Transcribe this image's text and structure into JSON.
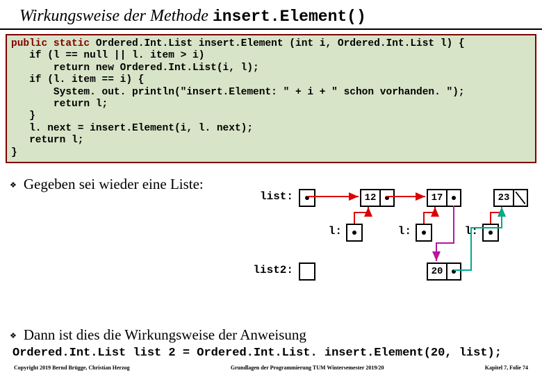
{
  "title": {
    "prefix": "Wirkungsweise der Methode ",
    "method": "insert.Element()"
  },
  "code": {
    "l1a": "public static ",
    "l1b": "Ordered.Int.List",
    "l1c": " insert.Element (int i, ",
    "l1d": "Ordered.Int.List",
    "l1e": " l) {",
    "l2": "   if (l == null || l. item > i)",
    "l3": "       return new Ordered.Int.List(i, l);",
    "l4": "   if (l. item == i) {",
    "l5": "       System. out. println(\"insert.Element: \" + i + \" schon vorhanden. \");",
    "l6": "       return l;",
    "l7": "   }",
    "l8": "   l. next = insert.Element(i, l. next);",
    "l9": "   return l;",
    "l10": "}"
  },
  "bullet1": "Gegeben sei wieder eine Liste:",
  "bullet2": "Dann ist dies die Wirkungsweise der Anweisung",
  "invocation": "Ordered.Int.List list 2 = Ordered.Int.List. insert.Element(20, list);",
  "diagram": {
    "list_label": "list:",
    "l_label_1": "l:",
    "l_label_2": "l:",
    "l_label_3": "l:",
    "list2_label": "list2:",
    "n1": "12",
    "n2": "17",
    "n3": "23",
    "new": "20"
  },
  "footer": {
    "left": "Copyright 2019 Bernd Brügge, Christian Herzog",
    "mid": "Grundlagen der Programmierung TUM Wintersemester 2019/20",
    "right": "Kapitel 7, Folie 74"
  }
}
